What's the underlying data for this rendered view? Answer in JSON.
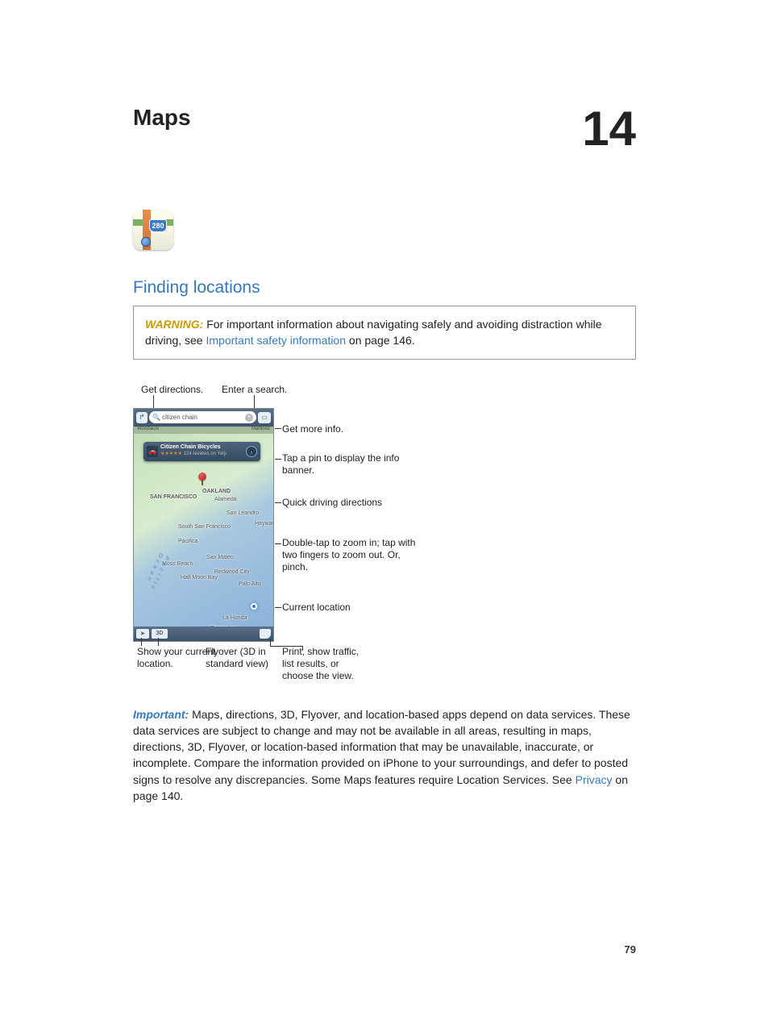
{
  "chapter": {
    "title": "Maps",
    "number": "14"
  },
  "app_icon": {
    "shield": "280"
  },
  "section": {
    "heading": "Finding locations"
  },
  "warning": {
    "label": "WARNING:",
    "text_before": "For important information about navigating safely and avoiding distraction while driving, see ",
    "link": "Important safety information",
    "text_after": " on page 146."
  },
  "figure": {
    "top_labels": {
      "directions": "Get directions.",
      "search": "Enter a search."
    },
    "search_field": {
      "placeholder": "citizen chain"
    },
    "label_strip": {
      "left": "Woodacre",
      "right": "Martinez"
    },
    "banner": {
      "title": "Citizen Chain Bicycles",
      "stars": "★★★★★",
      "reviews": "124 reviews on Yelp"
    },
    "map_labels": {
      "sf": "SAN FRANCISCO",
      "oakland": "OAKLAND",
      "alameda": "Alameda",
      "sanleandro": "San Leandro",
      "southsf": "South San Francisco",
      "pacifica": "Pacifica",
      "sanmateo": "San Mateo",
      "halfmoon": "Half Moon Bay",
      "paloalto": "Palo Alto",
      "redwood": "Redwood City",
      "mossbeach": "Moss Beach",
      "laHonda": "La Honda",
      "pescadero": "Pescadero",
      "hayward": "Hayward",
      "ocean": "Pacific Ocean"
    },
    "bottom_bar": {
      "threeD": "3D"
    },
    "right_callouts": {
      "more_info": "Get more info.",
      "pin": "Tap a pin to display the info banner.",
      "quick": "Quick driving directions",
      "zoom": "Double-tap to zoom in; tap with two fingers to zoom out. Or, pinch.",
      "current": "Current location"
    },
    "bottom_callouts": {
      "show_loc": "Show your current location.",
      "flyover": "Flyover (3D in standard view)",
      "curl": "Print, show traffic, list results, or choose the view."
    }
  },
  "important": {
    "label": "Important:",
    "text_before": "Maps, directions, 3D, Flyover, and location-based apps depend on data services. These data services are subject to change and may not be available in all areas, resulting in maps, directions, 3D, Flyover, or location-based information that may be unavailable, inaccurate, or incomplete. Compare the information provided on iPhone to your surroundings, and defer to posted signs to resolve any discrepancies. Some Maps features require Location Services. See ",
    "link": "Privacy",
    "text_after": " on page 140."
  },
  "page_number": "79"
}
